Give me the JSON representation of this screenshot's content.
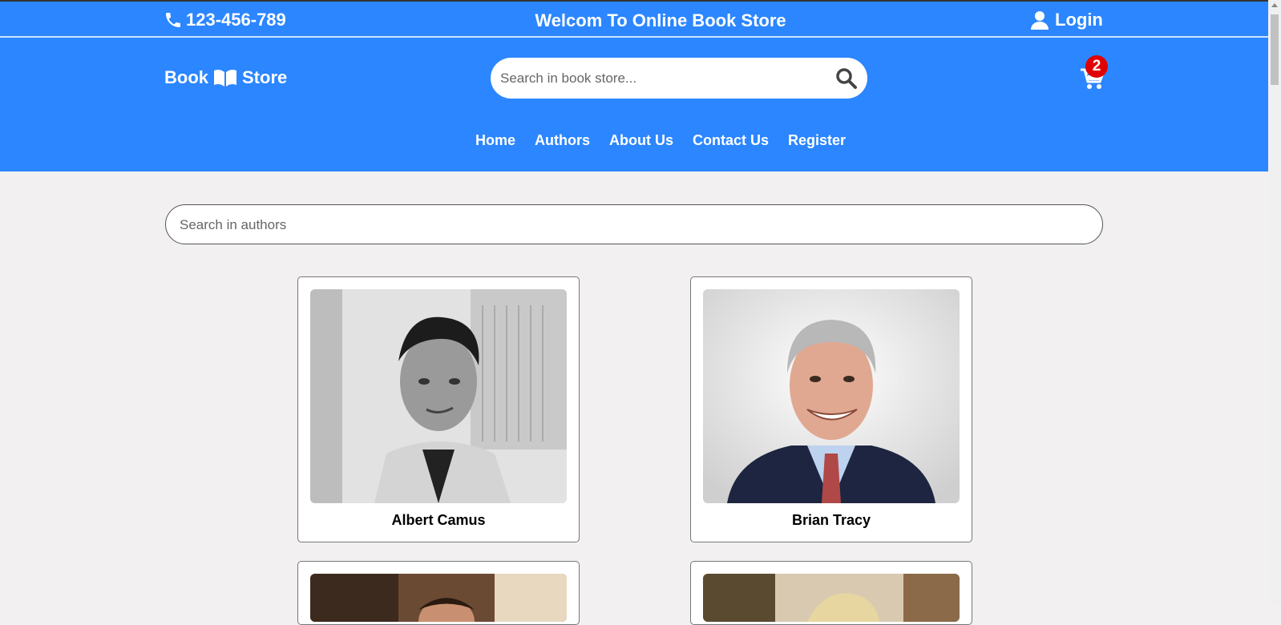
{
  "topbar": {
    "phone": "123-456-789",
    "welcome": "Welcom To Online Book Store",
    "login": "Login"
  },
  "header": {
    "logo_left": "Book",
    "logo_right": "Store",
    "search_placeholder": "Search in book store...",
    "cart_count": "2"
  },
  "nav": {
    "items": [
      {
        "label": "Home"
      },
      {
        "label": "Authors"
      },
      {
        "label": "About Us"
      },
      {
        "label": "Contact Us"
      },
      {
        "label": "Register"
      }
    ]
  },
  "authors_search": {
    "placeholder": "Search in authors"
  },
  "authors": [
    {
      "name": "Albert Camus"
    },
    {
      "name": "Brian Tracy"
    },
    {
      "name": ""
    },
    {
      "name": ""
    }
  ],
  "colors": {
    "brand": "#2b86ff",
    "badge": "#e00000",
    "background": "#f2f0f0"
  }
}
